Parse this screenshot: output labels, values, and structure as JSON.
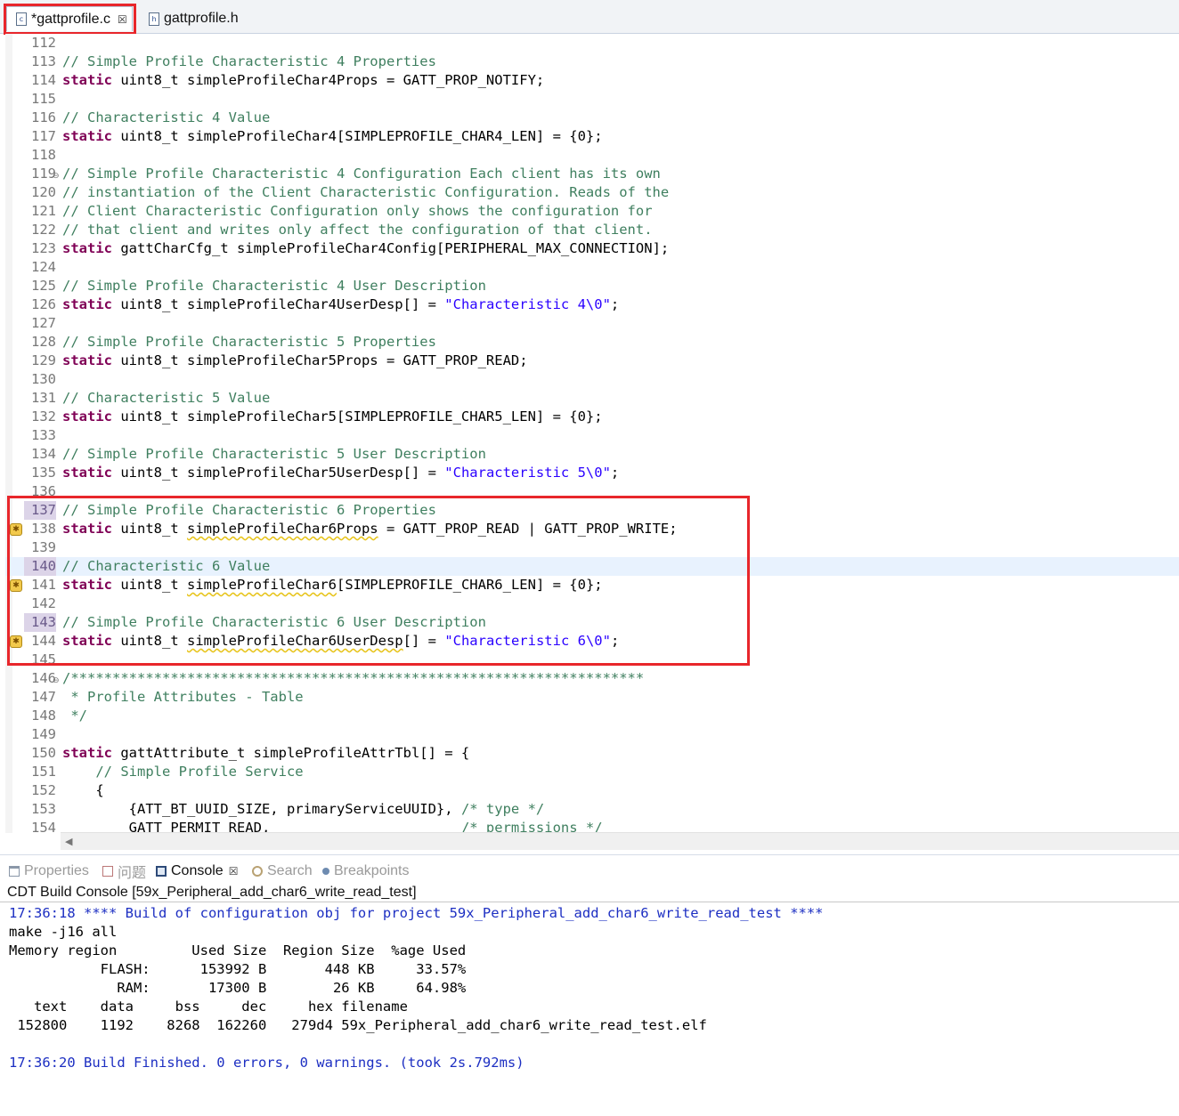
{
  "tabs": {
    "active": {
      "label": "*gattprofile.c",
      "icon": "c-file-icon",
      "icon_glyph": "c"
    },
    "inactive": {
      "label": "gattprofile.h",
      "icon": "h-file-icon",
      "icon_glyph": "h"
    },
    "close_glyph": "☒"
  },
  "editor": {
    "scroll_left_glyph": "◀",
    "fold_glyph": "⊖",
    "warning_glyph": "✱",
    "lines": [
      {
        "n": "112",
        "parts": []
      },
      {
        "n": "113",
        "parts": [
          {
            "t": "// Simple Profile Characteristic 4 Properties",
            "c": "cm"
          }
        ]
      },
      {
        "n": "114",
        "parts": [
          {
            "t": "static",
            "c": "kw"
          },
          {
            "t": " uint8_t simpleProfileChar4Props = GATT_PROP_NOTIFY;"
          }
        ]
      },
      {
        "n": "115",
        "parts": []
      },
      {
        "n": "116",
        "parts": [
          {
            "t": "// Characteristic 4 Value",
            "c": "cm"
          }
        ]
      },
      {
        "n": "117",
        "parts": [
          {
            "t": "static",
            "c": "kw"
          },
          {
            "t": " uint8_t simpleProfileChar4[SIMPLEPROFILE_CHAR4_LEN] = {0};"
          }
        ]
      },
      {
        "n": "118",
        "parts": []
      },
      {
        "n": "119",
        "fold": true,
        "parts": [
          {
            "t": "// Simple Profile Characteristic 4 Configuration Each client has its own",
            "c": "cm"
          }
        ]
      },
      {
        "n": "120",
        "parts": [
          {
            "t": "// instantiation of the Client Characteristic Configuration. Reads of the",
            "c": "cm"
          }
        ]
      },
      {
        "n": "121",
        "parts": [
          {
            "t": "// Client Characteristic Configuration only shows the configuration for",
            "c": "cm"
          }
        ]
      },
      {
        "n": "122",
        "parts": [
          {
            "t": "// that client and writes only affect the configuration of that client.",
            "c": "cm"
          }
        ]
      },
      {
        "n": "123",
        "parts": [
          {
            "t": "static",
            "c": "kw"
          },
          {
            "t": " gattCharCfg_t simpleProfileChar4Config[PERIPHERAL_MAX_CONNECTION];"
          }
        ]
      },
      {
        "n": "124",
        "parts": []
      },
      {
        "n": "125",
        "parts": [
          {
            "t": "// Simple Profile Characteristic 4 User Description",
            "c": "cm"
          }
        ]
      },
      {
        "n": "126",
        "parts": [
          {
            "t": "static",
            "c": "kw"
          },
          {
            "t": " uint8_t simpleProfileChar4UserDesp[] = "
          },
          {
            "t": "\"Characteristic 4\\0\"",
            "c": "st"
          },
          {
            "t": ";"
          }
        ]
      },
      {
        "n": "127",
        "parts": []
      },
      {
        "n": "128",
        "parts": [
          {
            "t": "// Simple Profile Characteristic 5 Properties",
            "c": "cm"
          }
        ]
      },
      {
        "n": "129",
        "parts": [
          {
            "t": "static",
            "c": "kw"
          },
          {
            "t": " uint8_t simpleProfileChar5Props = GATT_PROP_READ;"
          }
        ]
      },
      {
        "n": "130",
        "parts": []
      },
      {
        "n": "131",
        "parts": [
          {
            "t": "// Characteristic 5 Value",
            "c": "cm"
          }
        ]
      },
      {
        "n": "132",
        "parts": [
          {
            "t": "static",
            "c": "kw"
          },
          {
            "t": " uint8_t simpleProfileChar5[SIMPLEPROFILE_CHAR5_LEN] = {0};"
          }
        ]
      },
      {
        "n": "133",
        "parts": []
      },
      {
        "n": "134",
        "parts": [
          {
            "t": "// Simple Profile Characteristic 5 User Description",
            "c": "cm"
          }
        ]
      },
      {
        "n": "135",
        "parts": [
          {
            "t": "static",
            "c": "kw"
          },
          {
            "t": " uint8_t simpleProfileChar5UserDesp[] = "
          },
          {
            "t": "\"Characteristic 5\\0\"",
            "c": "st"
          },
          {
            "t": ";"
          }
        ]
      },
      {
        "n": "136",
        "parts": []
      },
      {
        "n": "137",
        "occ": true,
        "parts": [
          {
            "t": "// Simple Profile Characteristic 6 Properties",
            "c": "cm"
          }
        ]
      },
      {
        "n": "138",
        "warn": true,
        "parts": [
          {
            "t": "static",
            "c": "kw"
          },
          {
            "t": " uint8_t "
          },
          {
            "t": "simpleProfileChar6Props",
            "c": "sq"
          },
          {
            "t": " = GATT_PROP_READ | GATT_PROP_WRITE;"
          }
        ]
      },
      {
        "n": "139",
        "parts": []
      },
      {
        "n": "140",
        "occ": true,
        "hl": true,
        "parts": [
          {
            "t": "// Characteristic 6 Value",
            "c": "cm"
          }
        ]
      },
      {
        "n": "141",
        "warn": true,
        "parts": [
          {
            "t": "static",
            "c": "kw"
          },
          {
            "t": " uint8_t "
          },
          {
            "t": "simpleProfileChar6",
            "c": "sq"
          },
          {
            "t": "[SIMPLEPROFILE_CHAR6_LEN] = {0};"
          }
        ]
      },
      {
        "n": "142",
        "parts": []
      },
      {
        "n": "143",
        "occ": true,
        "parts": [
          {
            "t": "// Simple Profile Characteristic 6 User Description",
            "c": "cm"
          }
        ]
      },
      {
        "n": "144",
        "warn": true,
        "parts": [
          {
            "t": "static",
            "c": "kw"
          },
          {
            "t": " uint8_t "
          },
          {
            "t": "simpleProfileChar6UserDesp",
            "c": "sq"
          },
          {
            "t": "[] = "
          },
          {
            "t": "\"Characteristic 6\\0\"",
            "c": "st"
          },
          {
            "t": ";"
          }
        ]
      },
      {
        "n": "145",
        "parts": []
      },
      {
        "n": "146",
        "fold": true,
        "parts": [
          {
            "t": "/*********************************************************************",
            "c": "cm"
          }
        ]
      },
      {
        "n": "147",
        "parts": [
          {
            "t": " * Profile Attributes - Table",
            "c": "cm"
          }
        ]
      },
      {
        "n": "148",
        "parts": [
          {
            "t": " */",
            "c": "cm"
          }
        ]
      },
      {
        "n": "149",
        "parts": []
      },
      {
        "n": "150",
        "parts": [
          {
            "t": "static",
            "c": "kw"
          },
          {
            "t": " gattAttribute_t simpleProfileAttrTbl[] = {"
          }
        ]
      },
      {
        "n": "151",
        "parts": [
          {
            "t": "    "
          },
          {
            "t": "// Simple Profile Service",
            "c": "cm"
          }
        ]
      },
      {
        "n": "152",
        "parts": [
          {
            "t": "    {"
          }
        ]
      },
      {
        "n": "153",
        "parts": [
          {
            "t": "        {ATT_BT_UUID_SIZE, primaryServiceUUID}, "
          },
          {
            "t": "/* type */",
            "c": "cm"
          }
        ]
      },
      {
        "n": "154",
        "parts": [
          {
            "t": "        GATT_PERMIT_READ,                       "
          },
          {
            "t": "/* permissions */",
            "c": "cm"
          }
        ]
      }
    ]
  },
  "views": {
    "tabs": [
      {
        "label": "Properties",
        "icon": "properties-icon",
        "cls": "i-prop",
        "active": false,
        "close": false
      },
      {
        "label": "问题",
        "icon": "problems-icon",
        "cls": "i-prob",
        "active": false,
        "close": false
      },
      {
        "label": "Console",
        "icon": "console-icon",
        "cls": "i-cons",
        "active": true,
        "close": true
      },
      {
        "label": "Search",
        "icon": "search-icon",
        "cls": "i-search",
        "active": false,
        "close": false
      },
      {
        "label": "Breakpoints",
        "icon": "breakpoints-icon",
        "cls": "i-bp",
        "active": false,
        "close": false
      }
    ]
  },
  "console": {
    "title": "CDT Build Console [59x_Peripheral_add_char6_write_read_test]",
    "lines": [
      {
        "t": "17:36:18 **** Build of configuration obj for project 59x_Peripheral_add_char6_write_read_test ****",
        "blue": true
      },
      {
        "t": "make -j16 all"
      },
      {
        "t": "Memory region         Used Size  Region Size  %age Used"
      },
      {
        "t": "           FLASH:      153992 B       448 KB     33.57%"
      },
      {
        "t": "             RAM:       17300 B        26 KB     64.98%"
      },
      {
        "t": "   text    data     bss     dec     hex filename"
      },
      {
        "t": " 152800    1192    8268  162260   279d4 59x_Peripheral_add_char6_write_read_test.elf"
      },
      {
        "t": ""
      },
      {
        "t": "17:36:20 Build Finished. 0 errors, 0 warnings. (took 2s.792ms)",
        "blue": true
      }
    ]
  }
}
